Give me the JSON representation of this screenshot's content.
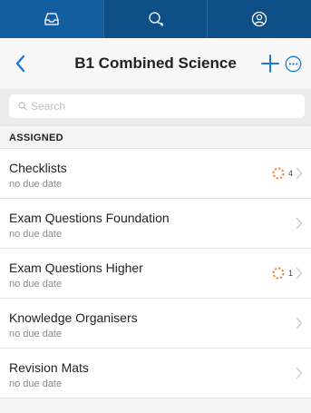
{
  "tabbar": {
    "tabs": [
      {
        "icon": "inbox-icon",
        "active": true
      },
      {
        "icon": "chat-bubbles-icon",
        "active": false
      },
      {
        "icon": "user-profile-icon",
        "active": false
      }
    ]
  },
  "navbar": {
    "back_icon": "chevron-left-icon",
    "title": "B1 Combined Science",
    "add_icon": "plus-icon",
    "more_icon": "more-circle-icon"
  },
  "search": {
    "placeholder": "Search",
    "value": ""
  },
  "section": {
    "label": "ASSIGNED"
  },
  "items": [
    {
      "name": "Checklists",
      "due": "no due date",
      "count": "4",
      "has_progress": true
    },
    {
      "name": "Exam Questions Foundation",
      "due": "no due date",
      "count": "",
      "has_progress": false
    },
    {
      "name": "Exam Questions Higher",
      "due": "no due date",
      "count": "1",
      "has_progress": true
    },
    {
      "name": "Knowledge Organisers",
      "due": "no due date",
      "count": "",
      "has_progress": false
    },
    {
      "name": "Revision Mats",
      "due": "no due date",
      "count": "",
      "has_progress": false
    }
  ],
  "colors": {
    "tabbar": "#0d4f86",
    "accent": "#1a7bd6",
    "progress": "#e8883a"
  }
}
